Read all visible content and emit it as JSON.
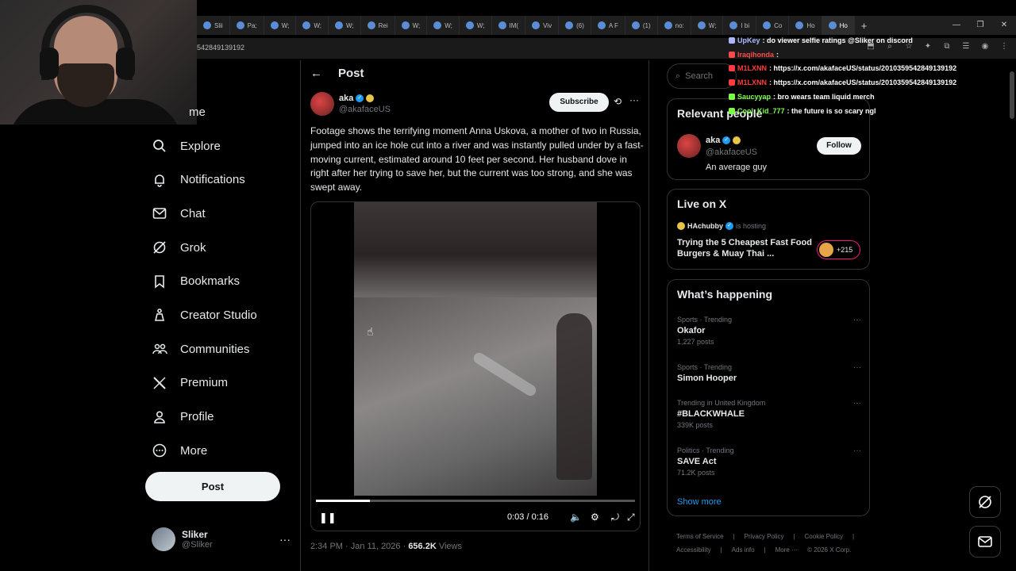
{
  "browser": {
    "tabs": [
      "Slii",
      "Pa;",
      "W;",
      "W;",
      "W;",
      "Rei",
      "W;",
      "W;",
      "W;",
      "IM(",
      "Viv",
      "(6)",
      "A F",
      "(1)",
      "no:",
      "W;",
      "I bi",
      "Co",
      "Ho",
      "Ho"
    ],
    "url": "542849139192",
    "newtab_icon": "+",
    "window_controls": [
      "—",
      "❐",
      "✕"
    ]
  },
  "nav": {
    "items": [
      {
        "label": "me",
        "icon": "home-icon"
      },
      {
        "label": "Explore",
        "icon": "search-icon"
      },
      {
        "label": "Notifications",
        "icon": "bell-icon"
      },
      {
        "label": "Chat",
        "icon": "mail-icon"
      },
      {
        "label": "Grok",
        "icon": "grok-icon"
      },
      {
        "label": "Bookmarks",
        "icon": "bookmark-icon"
      },
      {
        "label": "Creator Studio",
        "icon": "creator-icon"
      },
      {
        "label": "Communities",
        "icon": "communities-icon"
      },
      {
        "label": "Premium",
        "icon": "x-logo-icon"
      },
      {
        "label": "Profile",
        "icon": "person-icon"
      },
      {
        "label": "More",
        "icon": "more-circle-icon"
      }
    ],
    "post_label": "Post",
    "account": {
      "name": "Sliker",
      "handle": "@Sliker",
      "more": "···"
    }
  },
  "main": {
    "back_icon": "←",
    "title": "Post",
    "author": {
      "name": "aka",
      "handle": "@akafaceUS",
      "verified": "✓"
    },
    "subscribe_label": "Subscribe",
    "more_icon": "···",
    "text": "Footage shows the terrifying moment Anna Uskova, a mother of two in Russia, jumped into an ice hole cut into a river and was instantly pulled under by a fast-moving current, estimated around 10 feet per second. Her husband dove in right after her trying to save her, but the current was too strong, and she was swept away.",
    "video": {
      "time": "0:03 / 0:16",
      "progress": 0.17,
      "pause_icon": "❚❚",
      "volume_icon": "🔈",
      "settings_icon": "⚙",
      "rotate_icon": "⤾",
      "fullscreen_icon": "⤢"
    },
    "meta": {
      "time": "2:34 PM · Jan 11, 2026 · ",
      "views": "656.2K",
      "views_label": " Views"
    }
  },
  "right": {
    "search_placeholder": "Search",
    "search_icon": "⌕",
    "relevant": {
      "title": "Relevant people",
      "name": "aka",
      "handle": "@akafaceUS",
      "bio": "An average guy",
      "follow_label": "Follow"
    },
    "live": {
      "title": "Live on X",
      "host": "HAchubby",
      "hosting": "is hosting",
      "stream_title": "Trying the 5 Cheapest Fast Food Burgers & Muay Thai ...",
      "count": "+215"
    },
    "happening": {
      "title": "What’s happening",
      "trends": [
        {
          "context": "Sports · Trending",
          "name": "Okafor",
          "posts": "1,227 posts"
        },
        {
          "context": "Sports · Trending",
          "name": "Simon Hooper",
          "posts": ""
        },
        {
          "context": "Trending in United Kingdom",
          "name": "#BLACKWHALE",
          "posts": "339K posts"
        },
        {
          "context": "Politics · Trending",
          "name": "SAVE Act",
          "posts": "71.2K posts"
        }
      ],
      "more_icon": "···",
      "show_more": "Show more"
    },
    "footer": [
      "Terms of Service",
      "|",
      "Privacy Policy",
      "|",
      "Cookie Policy",
      "|",
      "Accessibility",
      "|",
      "Ads info",
      "|",
      "More ···",
      "© 2026 X Corp."
    ]
  },
  "chat": {
    "messages": [
      {
        "user": "UpKey",
        "text": ": do viewer selfie ratings @Sliker on discord",
        "color": "#aab7ff"
      },
      {
        "user": "Iraqihonda",
        "text": ":",
        "color": "#ff4a4a"
      },
      {
        "user": "M1LXNN",
        "text": ": https://x.com/akafaceUS/status/2010359542849139192",
        "color": "#ff3b3b"
      },
      {
        "user": "M1LXNN",
        "text": ": https://x.com/akafaceUS/status/2010359542849139192",
        "color": "#ff3b3b"
      },
      {
        "user": "Saucyyap",
        "text": ": bro wears team liquid merch",
        "color": "#7cff4a"
      },
      {
        "user": "Cool_Kid_777",
        "text": ": the future is so scary ngl",
        "color": "#7cff4a"
      }
    ]
  }
}
